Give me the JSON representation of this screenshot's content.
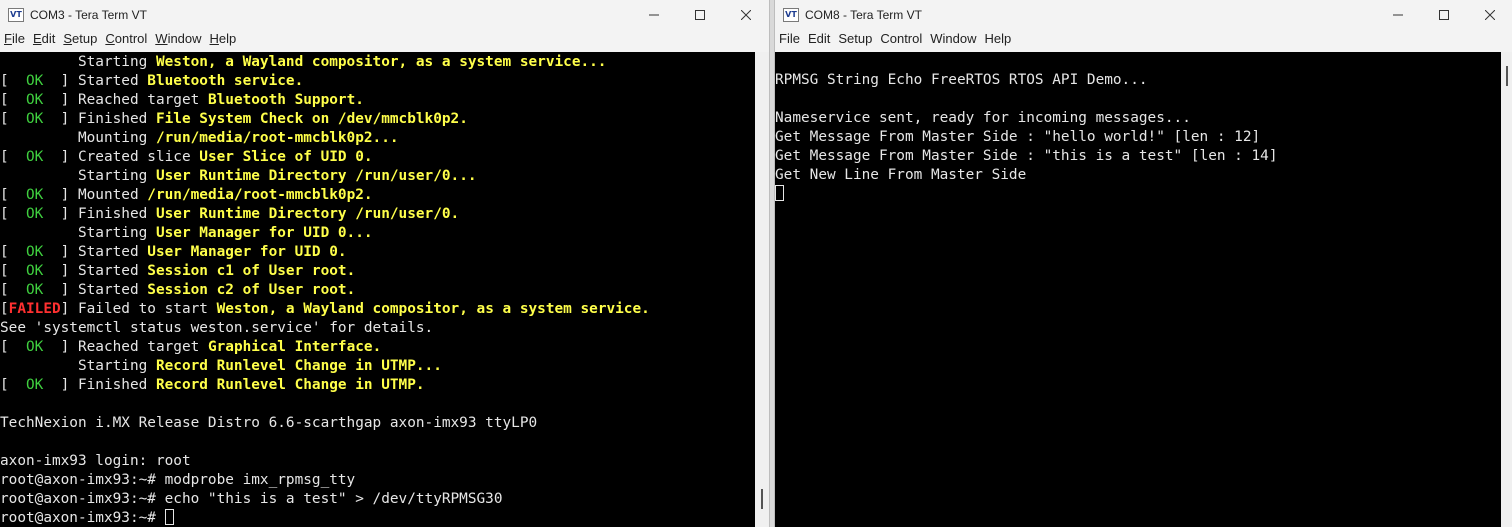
{
  "left": {
    "title": "COM3 - Tera Term VT",
    "menu": [
      {
        "pre": "",
        "u": "F",
        "post": "ile"
      },
      {
        "pre": "",
        "u": "E",
        "post": "dit"
      },
      {
        "pre": "",
        "u": "S",
        "post": "etup"
      },
      {
        "pre": "",
        "u": "C",
        "post": "ontrol"
      },
      {
        "pre": "",
        "u": "W",
        "post": "indow"
      },
      {
        "pre": "",
        "u": "H",
        "post": "elp"
      }
    ],
    "lines": [
      [
        [
          "",
          "         Starting "
        ],
        [
          "hl",
          "Weston, a Wayland compositor, as a system service..."
        ]
      ],
      [
        [
          "",
          "[  "
        ],
        [
          "ok",
          "OK"
        ],
        [
          "",
          "  ] Started "
        ],
        [
          "hl",
          "Bluetooth service."
        ]
      ],
      [
        [
          "",
          "[  "
        ],
        [
          "ok",
          "OK"
        ],
        [
          "",
          "  ] Reached target "
        ],
        [
          "hl",
          "Bluetooth Support."
        ]
      ],
      [
        [
          "",
          "[  "
        ],
        [
          "ok",
          "OK"
        ],
        [
          "",
          "  ] Finished "
        ],
        [
          "hl",
          "File System Check on /dev/mmcblk0p2."
        ]
      ],
      [
        [
          "",
          "         Mounting "
        ],
        [
          "hl",
          "/run/media/root-mmcblk0p2..."
        ]
      ],
      [
        [
          "",
          "[  "
        ],
        [
          "ok",
          "OK"
        ],
        [
          "",
          "  ] Created slice "
        ],
        [
          "hl",
          "User Slice of UID 0."
        ]
      ],
      [
        [
          "",
          "         Starting "
        ],
        [
          "hl",
          "User Runtime Directory /run/user/0..."
        ]
      ],
      [
        [
          "",
          "[  "
        ],
        [
          "ok",
          "OK"
        ],
        [
          "",
          "  ] Mounted "
        ],
        [
          "hl",
          "/run/media/root-mmcblk0p2."
        ]
      ],
      [
        [
          "",
          "[  "
        ],
        [
          "ok",
          "OK"
        ],
        [
          "",
          "  ] Finished "
        ],
        [
          "hl",
          "User Runtime Directory /run/user/0."
        ]
      ],
      [
        [
          "",
          "         Starting "
        ],
        [
          "hl",
          "User Manager for UID 0..."
        ]
      ],
      [
        [
          "",
          "[  "
        ],
        [
          "ok",
          "OK"
        ],
        [
          "",
          "  ] Started "
        ],
        [
          "hl",
          "User Manager for UID 0."
        ]
      ],
      [
        [
          "",
          "[  "
        ],
        [
          "ok",
          "OK"
        ],
        [
          "",
          "  ] Started "
        ],
        [
          "hl",
          "Session c1 of User root."
        ]
      ],
      [
        [
          "",
          "[  "
        ],
        [
          "ok",
          "OK"
        ],
        [
          "",
          "  ] Started "
        ],
        [
          "hl",
          "Session c2 of User root."
        ]
      ],
      [
        [
          "",
          "["
        ],
        [
          "failed",
          "FAILED"
        ],
        [
          "",
          "] Failed to start "
        ],
        [
          "hl",
          "Weston, a Wayland compositor, as a system service."
        ]
      ],
      [
        [
          "",
          "See 'systemctl status weston.service' for details."
        ]
      ],
      [
        [
          "",
          "[  "
        ],
        [
          "ok",
          "OK"
        ],
        [
          "",
          "  ] Reached target "
        ],
        [
          "hl",
          "Graphical Interface."
        ]
      ],
      [
        [
          "",
          "         Starting "
        ],
        [
          "hl",
          "Record Runlevel Change in UTMP..."
        ]
      ],
      [
        [
          "",
          "[  "
        ],
        [
          "ok",
          "OK"
        ],
        [
          "",
          "  ] Finished "
        ],
        [
          "hl",
          "Record Runlevel Change in UTMP."
        ]
      ],
      [],
      [
        [
          "",
          "TechNexion i.MX Release Distro 6.6-scarthgap axon-imx93 ttyLP0"
        ]
      ],
      [],
      [
        [
          "",
          "axon-imx93 login: root"
        ]
      ],
      [
        [
          "",
          "root@axon-imx93:~# modprobe imx_rpmsg_tty"
        ]
      ],
      [
        [
          "",
          "root@axon-imx93:~# echo \"this is a test\" > /dev/ttyRPMSG30"
        ]
      ],
      [
        [
          "",
          "root@axon-imx93:~# "
        ],
        [
          "cursor",
          ""
        ]
      ]
    ]
  },
  "right": {
    "title": "COM8 - Tera Term VT",
    "menu": [
      {
        "pre": "File",
        "u": "",
        "post": ""
      },
      {
        "pre": "Edit",
        "u": "",
        "post": ""
      },
      {
        "pre": "Setup",
        "u": "",
        "post": ""
      },
      {
        "pre": "Control",
        "u": "",
        "post": ""
      },
      {
        "pre": "Window",
        "u": "",
        "post": ""
      },
      {
        "pre": "Help",
        "u": "",
        "post": ""
      }
    ],
    "lines": [
      [],
      [
        [
          "",
          "RPMSG String Echo FreeRTOS RTOS API Demo..."
        ]
      ],
      [],
      [
        [
          "",
          "Nameservice sent, ready for incoming messages..."
        ]
      ],
      [
        [
          "",
          "Get Message From Master Side : \"hello world!\" [len : 12]"
        ]
      ],
      [
        [
          "",
          "Get Message From Master Side : \"this is a test\" [len : 14]"
        ]
      ],
      [
        [
          "",
          "Get New Line From Master Side"
        ]
      ],
      [
        [
          "cursor",
          ""
        ]
      ]
    ]
  },
  "icons": {
    "app": "tera-term-icon",
    "minimize": "minimize-icon",
    "maximize": "maximize-icon",
    "close": "close-icon"
  },
  "app_icon_text": "VT",
  "colors": {
    "ok": "#3fcf3f",
    "failed": "#ff3030",
    "highlight": "#ffff4a",
    "terminal_bg": "#000000",
    "terminal_fg": "#e6e6e6"
  }
}
